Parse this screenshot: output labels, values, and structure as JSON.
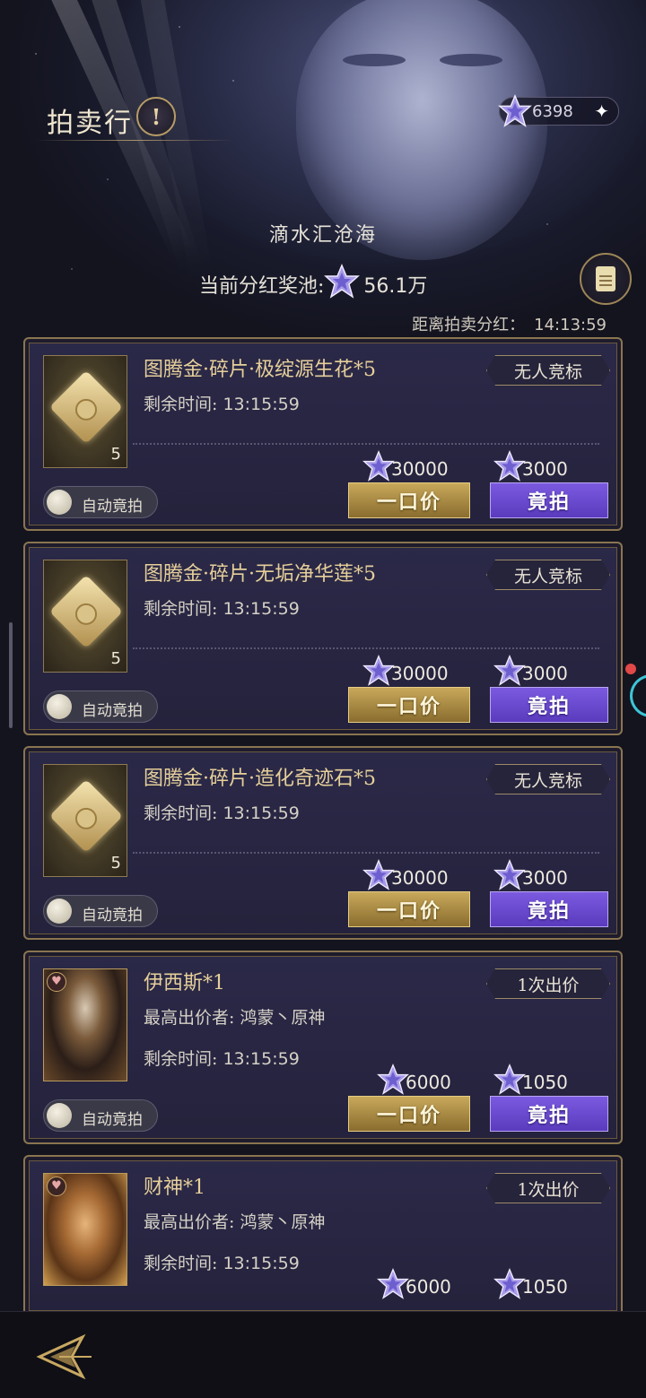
{
  "header": {
    "title": "拍卖行",
    "info_icon": "exclamation-icon",
    "currency": {
      "icon": "star-gem-icon",
      "amount": "6398",
      "add_icon": "plus-sparkle-icon"
    }
  },
  "banner": {
    "subtitle": "滴水汇沧海",
    "pool_label": "当前分红奖池:",
    "pool_value": "56.1万",
    "notice_icon": "notice-document-icon",
    "countdown_label": "距离拍卖分红：",
    "countdown_time": "14:13:59"
  },
  "colors": {
    "gold": "#c8a85a",
    "purple": "#6b4ad0",
    "card_bg": "#2b2948",
    "border": "#8a7550"
  },
  "auction_items": [
    {
      "name": "图腾金·碎片·极绽源生花*5",
      "thumb_icon": "puzzle-piece-icon",
      "count": "5",
      "status": "无人竞标",
      "remaining_label": "剩余时间:",
      "remaining": "13:15:59",
      "buyout_price": "30000",
      "bid_price": "3000",
      "buyout_label": "一口价",
      "bid_label": "竟拍",
      "auto_label": "自动竟拍"
    },
    {
      "name": "图腾金·碎片·无垢净华莲*5",
      "thumb_icon": "puzzle-piece-icon",
      "count": "5",
      "status": "无人竞标",
      "remaining_label": "剩余时间:",
      "remaining": "13:15:59",
      "buyout_price": "30000",
      "bid_price": "3000",
      "buyout_label": "一口价",
      "bid_label": "竟拍",
      "auto_label": "自动竟拍"
    },
    {
      "name": "图腾金·碎片·造化奇迹石*5",
      "thumb_icon": "puzzle-piece-icon",
      "count": "5",
      "status": "无人竞标",
      "remaining_label": "剩余时间:",
      "remaining": "13:15:59",
      "buyout_price": "30000",
      "bid_price": "3000",
      "buyout_label": "一口价",
      "bid_label": "竟拍",
      "auto_label": "自动竟拍"
    },
    {
      "name": "伊西斯*1",
      "thumb_icon": "character-portrait-isis",
      "status": "1次出价",
      "bidder_label": "最高出价者:",
      "bidder": "鸿蒙丶原神",
      "remaining_label": "剩余时间:",
      "remaining": "13:15:59",
      "buyout_price": "6000",
      "bid_price": "1050",
      "buyout_label": "一口价",
      "bid_label": "竟拍",
      "auto_label": "自动竟拍"
    },
    {
      "name": "财神*1",
      "thumb_icon": "character-portrait-caishen",
      "status": "1次出价",
      "bidder_label": "最高出价者:",
      "bidder": "鸿蒙丶原神",
      "remaining_label": "剩余时间:",
      "remaining": "13:15:59",
      "buyout_price": "6000",
      "bid_price": "1050"
    }
  ],
  "footer": {
    "back_icon": "back-arrow-icon"
  }
}
